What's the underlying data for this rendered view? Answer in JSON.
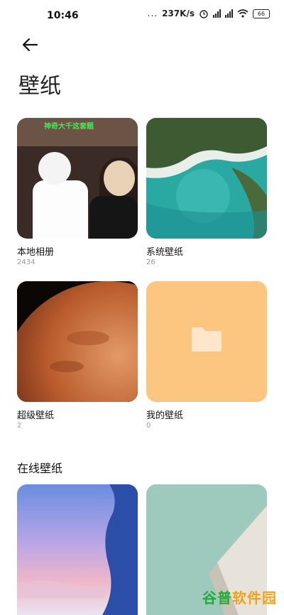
{
  "status_bar": {
    "time": "10:46",
    "dots": "...",
    "net_speed": "237K/s",
    "battery": "66"
  },
  "header": {
    "back_icon": "arrow-left-icon",
    "title": "壁纸"
  },
  "albums": [
    {
      "label": "本地相册",
      "count": "2434",
      "thumb_caption": "神奇大千这套题"
    },
    {
      "label": "系统壁纸",
      "count": "26"
    },
    {
      "label": "超级壁纸",
      "count": "2"
    },
    {
      "label": "我的壁纸",
      "count": "0",
      "icon": "folder-icon",
      "accent": "#fcc681"
    }
  ],
  "online_section": {
    "title": "在线壁纸"
  },
  "watermark": {
    "part1": "谷普",
    "part2": "软件园"
  }
}
